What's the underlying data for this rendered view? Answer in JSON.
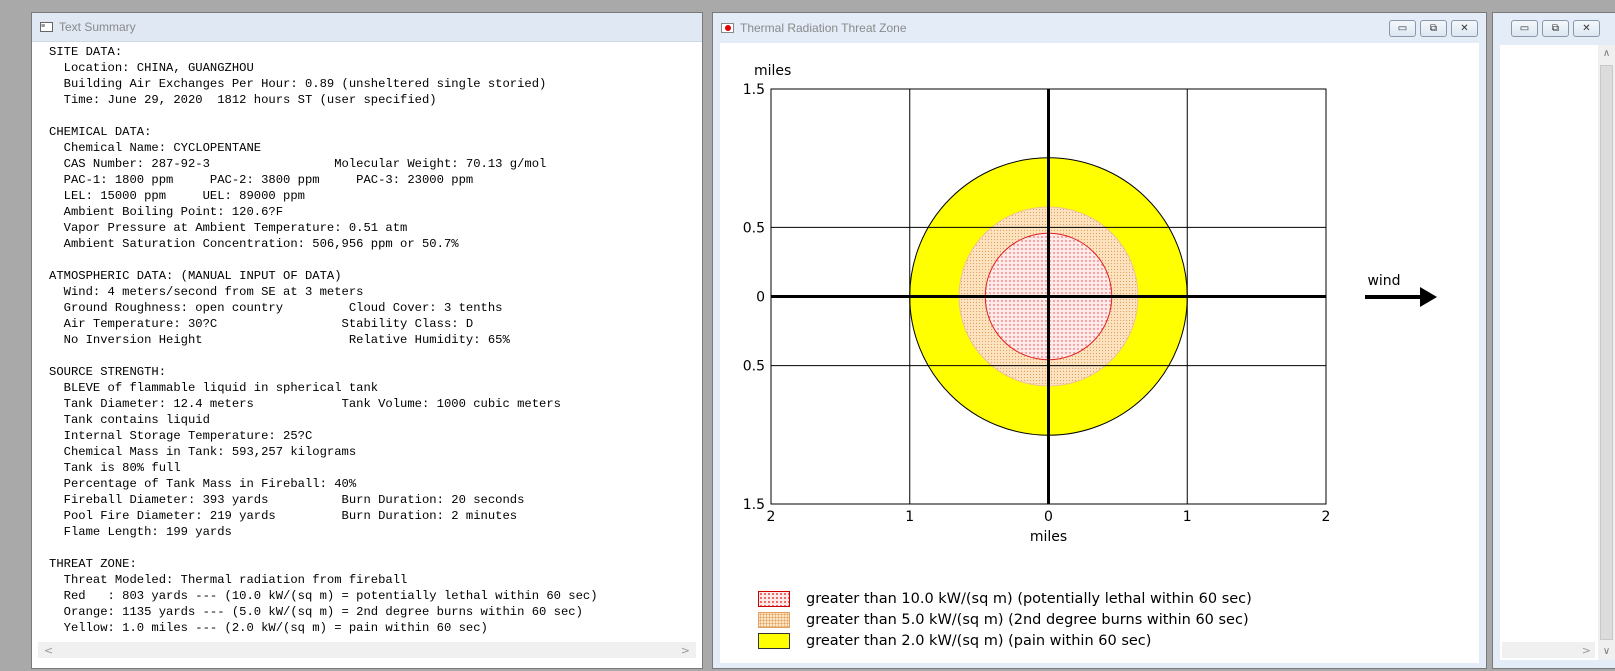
{
  "summary_window": {
    "title": "Text Summary",
    "icon": "text-document-icon",
    "lines": [
      "SITE DATA:",
      "  Location: CHINA, GUANGZHOU",
      "  Building Air Exchanges Per Hour: 0.89 (unsheltered single storied)",
      "  Time: June 29, 2020  1812 hours ST (user specified)",
      "",
      "CHEMICAL DATA:",
      "  Chemical Name: CYCLOPENTANE",
      "  CAS Number: 287-92-3                 Molecular Weight: 70.13 g/mol",
      "  PAC-1: 1800 ppm     PAC-2: 3800 ppm     PAC-3: 23000 ppm",
      "  LEL: 15000 ppm     UEL: 89000 ppm",
      "  Ambient Boiling Point: 120.6?F",
      "  Vapor Pressure at Ambient Temperature: 0.51 atm",
      "  Ambient Saturation Concentration: 506,956 ppm or 50.7%",
      "",
      "ATMOSPHERIC DATA: (MANUAL INPUT OF DATA)",
      "  Wind: 4 meters/second from SE at 3 meters",
      "  Ground Roughness: open country         Cloud Cover: 3 tenths",
      "  Air Temperature: 30?C                 Stability Class: D",
      "  No Inversion Height                    Relative Humidity: 65%",
      "",
      "SOURCE STRENGTH:",
      "  BLEVE of flammable liquid in spherical tank",
      "  Tank Diameter: 12.4 meters            Tank Volume: 1000 cubic meters",
      "  Tank contains liquid",
      "  Internal Storage Temperature: 25?C",
      "  Chemical Mass in Tank: 593,257 kilograms",
      "  Tank is 80% full",
      "  Percentage of Tank Mass in Fireball: 40%",
      "  Fireball Diameter: 393 yards          Burn Duration: 20 seconds",
      "  Pool Fire Diameter: 219 yards         Burn Duration: 2 minutes",
      "  Flame Length: 199 yards",
      "",
      "THREAT ZONE:",
      "  Threat Modeled: Thermal radiation from fireball",
      "  Red   : 803 yards --- (10.0 kW/(sq m) = potentially lethal within 60 sec)",
      "  Orange: 1135 yards --- (5.0 kW/(sq m) = 2nd degree burns within 60 sec)",
      "  Yellow: 1.0 miles --- (2.0 kW/(sq m) = pain within 60 sec)"
    ],
    "scroll_left": "<",
    "scroll_right": ">"
  },
  "chart_window": {
    "title": "Thermal Radiation Threat Zone",
    "icon": "threat-zone-icon",
    "controls": {
      "minimize": "▭",
      "maximize": "⧉",
      "close": "✕"
    }
  },
  "right_window": {
    "controls": {
      "minimize": "▭",
      "maximize": "⧉",
      "close": "✕"
    },
    "scroll_up": "∧",
    "scroll_down": "∨",
    "scroll_right": ">"
  },
  "chart_data": {
    "type": "area",
    "xlabel": "miles",
    "ylabel": "miles",
    "xlim": [
      -2,
      2
    ],
    "ylim": [
      -1.5,
      1.5
    ],
    "x_ticks": [
      -2,
      -1,
      0,
      1,
      2
    ],
    "x_tick_labels": [
      "2",
      "1",
      "0",
      "1",
      "2"
    ],
    "y_ticks": [
      1.5,
      0.5,
      0,
      -0.5,
      -1.5
    ],
    "y_tick_labels": [
      "1.5",
      "0.5",
      "0",
      "0.5",
      "1.5"
    ],
    "grid": true,
    "wind_label": "wind",
    "wind_direction": "right",
    "zones": [
      {
        "color": "#ffff00",
        "radius_miles": 1.0,
        "label": "greater than 2.0 kW/(sq m) (pain within 60 sec)"
      },
      {
        "color": "#fde3c0",
        "radius_miles": 0.645,
        "label": "greater than 5.0 kW/(sq m) (2nd degree burns within 60 sec)"
      },
      {
        "color": "#ffeaea",
        "radius_miles": 0.456,
        "label": "greater than 10.0 kW/(sq m) (potentially lethal within 60 sec)"
      }
    ],
    "legend": [
      {
        "swatch": "red",
        "label": "greater than 10.0 kW/(sq m) (potentially lethal within 60 sec)"
      },
      {
        "swatch": "orange",
        "label": "greater than 5.0 kW/(sq m) (2nd degree burns within 60 sec)"
      },
      {
        "swatch": "yellow",
        "label": "greater than 2.0 kW/(sq m) (pain within 60 sec)"
      }
    ],
    "legend_position": "bottom-left"
  }
}
